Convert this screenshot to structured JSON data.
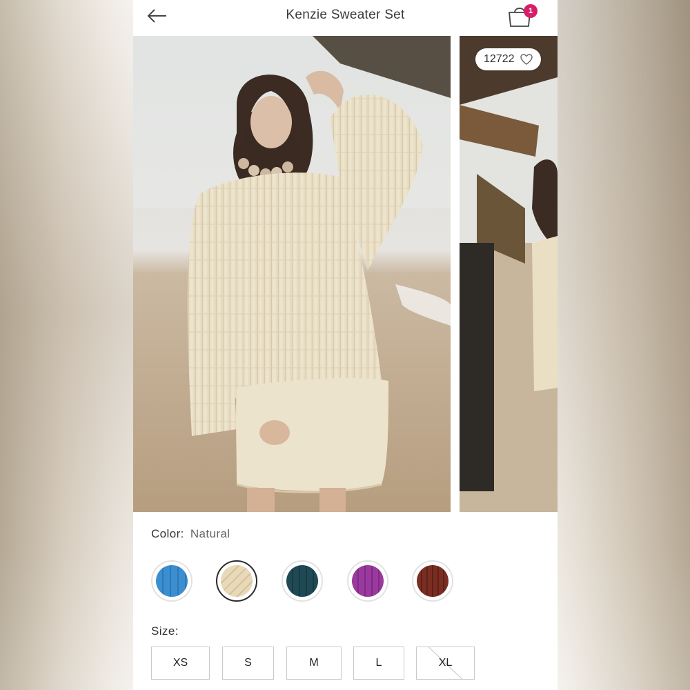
{
  "header": {
    "title": "Kenzie Sweater Set",
    "back_icon": "arrow-left-icon",
    "bag_icon": "shopping-bag-icon",
    "bag_count": "1",
    "badge_color": "#d61f69"
  },
  "gallery": {
    "like_count": "12722",
    "like_icon": "heart-outline-icon"
  },
  "color": {
    "label": "Color:",
    "selected": "Natural",
    "swatches": [
      {
        "color": "#3b8fd1",
        "selected": false
      },
      {
        "color": "#e8d9b8",
        "selected": true
      },
      {
        "color": "#1f4a55",
        "selected": false
      },
      {
        "color": "#9b3a9e",
        "selected": false
      },
      {
        "color": "#7a2e22",
        "selected": false
      }
    ]
  },
  "size": {
    "label": "Size:",
    "options": [
      {
        "label": "XS",
        "available": true
      },
      {
        "label": "S",
        "available": true
      },
      {
        "label": "M",
        "available": true
      },
      {
        "label": "L",
        "available": true
      },
      {
        "label": "XL",
        "available": false
      }
    ]
  }
}
